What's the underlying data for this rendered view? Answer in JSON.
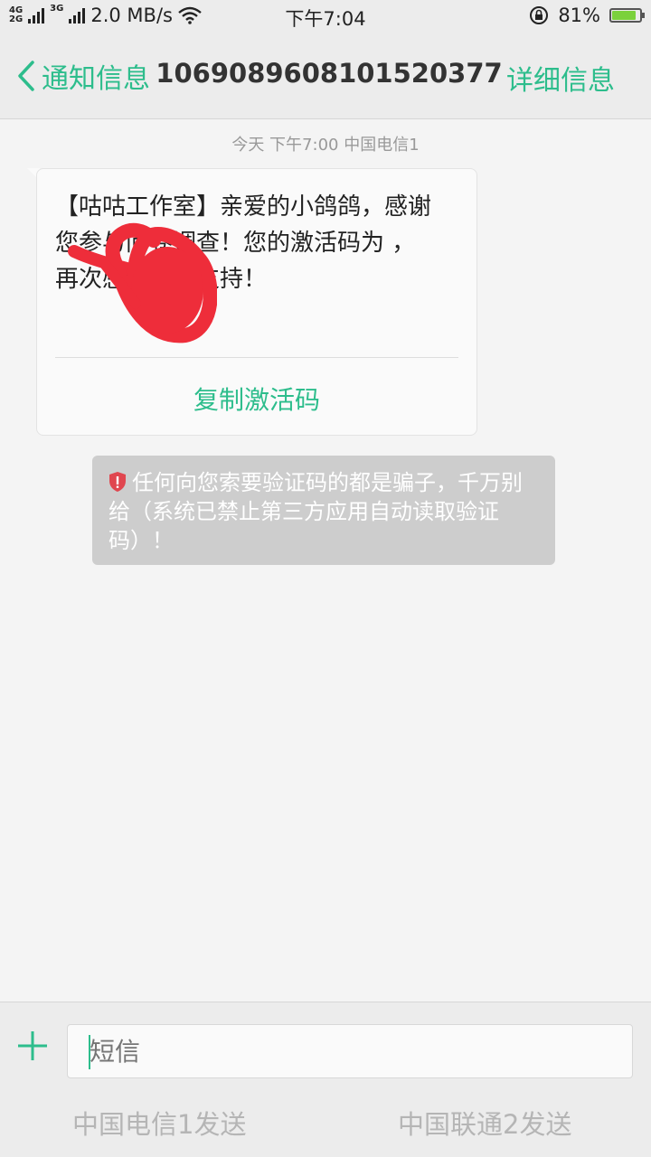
{
  "status_bar": {
    "network_top": "4G",
    "network_bottom": "2G",
    "network2": "3G",
    "speed": "2.0 MB/s",
    "time": "下午7:04",
    "battery": "81%"
  },
  "header": {
    "back_label": "通知信息",
    "number": "1069089608101520377",
    "detail_label": "详细信息"
  },
  "conversation": {
    "timestamp": "今天 下午7:00  中国电信1",
    "message": {
      "text": "【咕咕工作室】亲爱的小鸽鸽，感谢您参与问卷调查！您的激活码为          ，再次感谢您的支持！",
      "copy_label": "复制激活码"
    },
    "warning": "任何向您索要验证码的都是骗子，千万别给（系统已禁止第三方应用自动读取验证码）！"
  },
  "input": {
    "placeholder": "短信",
    "send_sim1": "中国电信1发送",
    "send_sim2": "中国联通2发送"
  },
  "colors": {
    "accent": "#2dbd8c",
    "redaction": "#ee2d3a",
    "warning_bg": "#cdcdcd",
    "shield": "#e0464f"
  }
}
